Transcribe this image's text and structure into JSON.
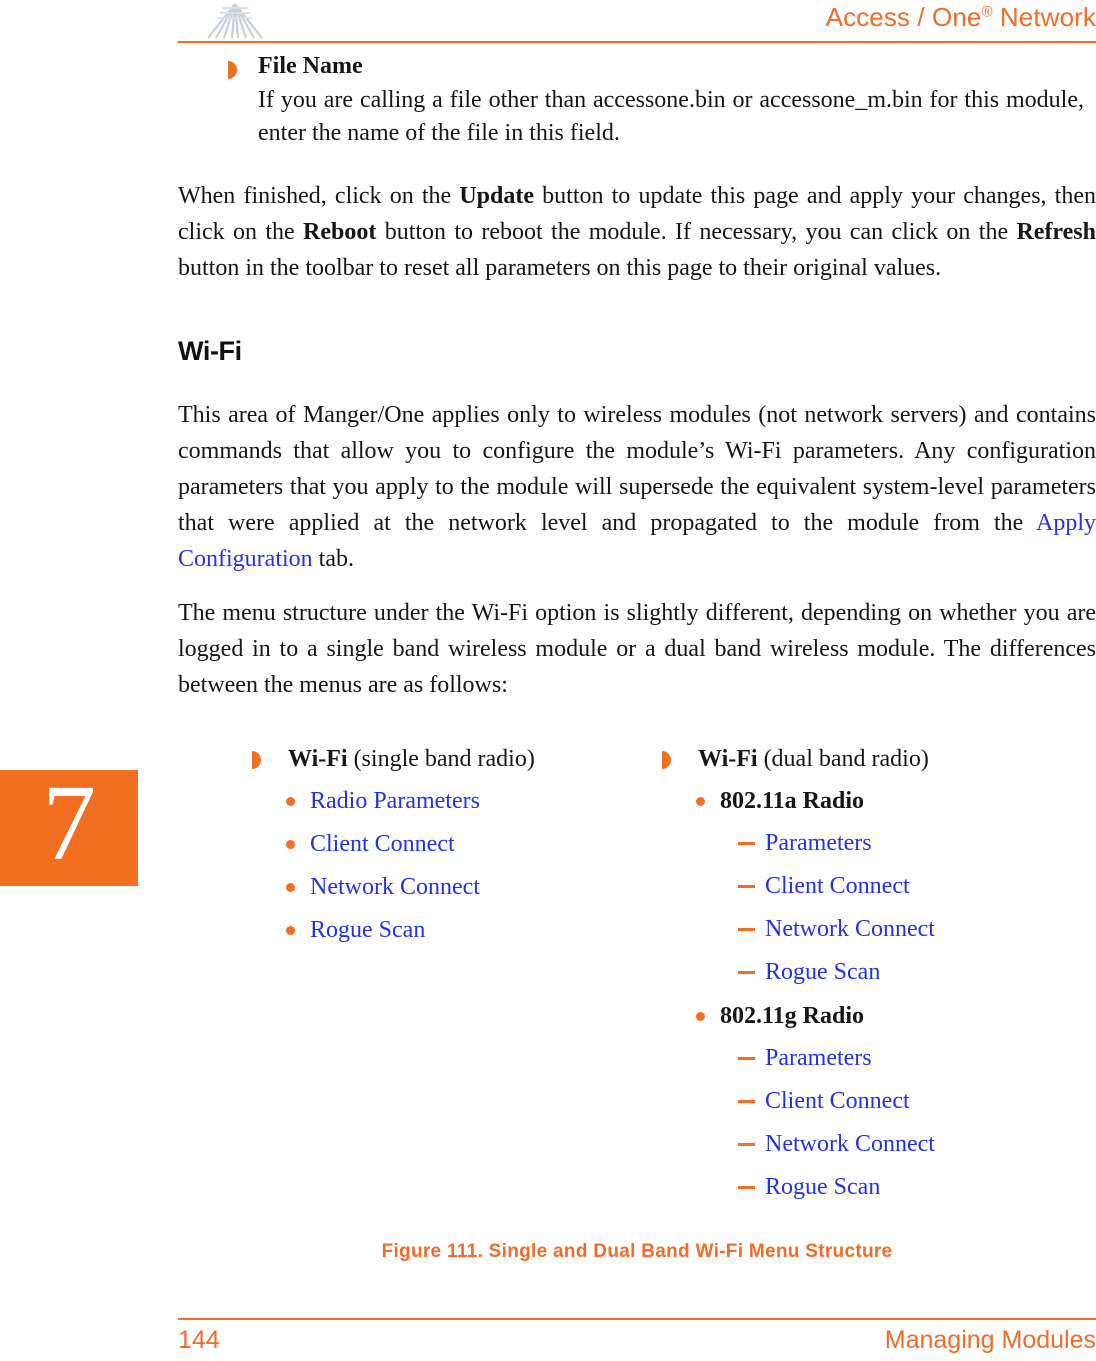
{
  "header": {
    "title_main": "Access / One",
    "title_sup": "®",
    "title_tail": " Network",
    "logo_icon": "antenna-fan-logo",
    "accent_color": "#ef6c2a"
  },
  "chapter_tab": {
    "number": "7",
    "background_color": "#f26f21",
    "text_color": "#ffffff"
  },
  "content": {
    "file_name_item": {
      "bullet_icon": "orange-half-disc-bullet",
      "title": "File Name",
      "body": "If you are calling a file other than accessone.bin or accessone_m.bin for this module, enter the name of the file in this field."
    },
    "paragraph_update": {
      "part1": "When finished, click on the ",
      "bold1": "Update",
      "part2": " button to update this page and apply your changes, then click on the ",
      "bold2": "Reboot",
      "part3": " button to reboot the module. If necessary, you can click on the ",
      "bold3": "Refresh",
      "part4": " button in the toolbar to reset all parameters on this page to their original values."
    },
    "section_heading": "Wi-Fi",
    "paragraph_wifi": {
      "part1": "This area of Manger/One applies only to wireless modules (not network servers) and contains commands that allow you to configure the module’s Wi-Fi parameters. Any configuration parameters that you apply to the module will supersede the equivalent system-level parameters that were applied at the network level and propagated to the module from the ",
      "link": "Apply Configuration",
      "part2": " tab."
    },
    "paragraph_menu_structure": "The menu structure under the Wi-Fi option is slightly different, depending on whether you are logged in to a single band wireless module or a dual band wireless module. The differences between the menus are as follows:"
  },
  "menu_structure": {
    "single_band": {
      "root_bold": "Wi-Fi",
      "root_plain": " (single band radio)",
      "items": [
        {
          "label": "Radio Parameters",
          "style": "link"
        },
        {
          "label": "Client Connect",
          "style": "link"
        },
        {
          "label": "Network Connect",
          "style": "link"
        },
        {
          "label": "Rogue Scan",
          "style": "link"
        }
      ]
    },
    "dual_band": {
      "root_bold": "Wi-Fi",
      "root_plain": " (dual band radio)",
      "groups": [
        {
          "label": "802.11a Radio",
          "style": "bold",
          "children": [
            "Parameters",
            "Client Connect",
            "Network Connect",
            "Rogue Scan"
          ]
        },
        {
          "label": "802.11g Radio",
          "style": "bold",
          "children": [
            "Parameters",
            "Client Connect",
            "Network Connect",
            "Rogue Scan"
          ]
        }
      ]
    }
  },
  "figure": {
    "caption": "Figure 111. Single and Dual Band Wi-Fi Menu Structure"
  },
  "footer": {
    "page_number": "144",
    "section_label": "Managing Modules"
  },
  "colors": {
    "orange": "#f26f21",
    "header_orange": "#ef6c2a",
    "link_blue": "#2432e0",
    "body_text": "#161616"
  }
}
